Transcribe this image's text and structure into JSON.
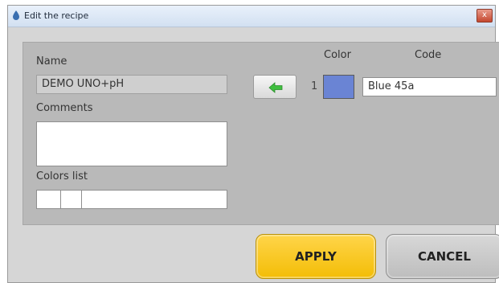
{
  "window": {
    "title": "Edit the recipe",
    "icon": "water-drop-icon",
    "close_glyph": "x"
  },
  "form": {
    "name_label": "Name",
    "name_value": "DEMO UNO+pH",
    "comments_label": "Comments",
    "comments_value": "",
    "colors_list_label": "Colors list"
  },
  "colors_table": {
    "color_header": "Color",
    "code_header": "Code",
    "rows": [
      {
        "index": "1",
        "swatch_color": "#6a84d4",
        "code": "Blue 45a"
      }
    ]
  },
  "actions": {
    "transfer_icon": "green-left-arrow-icon",
    "apply_label": "APPLY",
    "cancel_label": "CANCEL"
  },
  "colors": {
    "apply_button": "#f6c20f",
    "cancel_button": "#c9c9c9",
    "arrow_green": "#3fbf3f",
    "panel": "#b9b9b9"
  }
}
